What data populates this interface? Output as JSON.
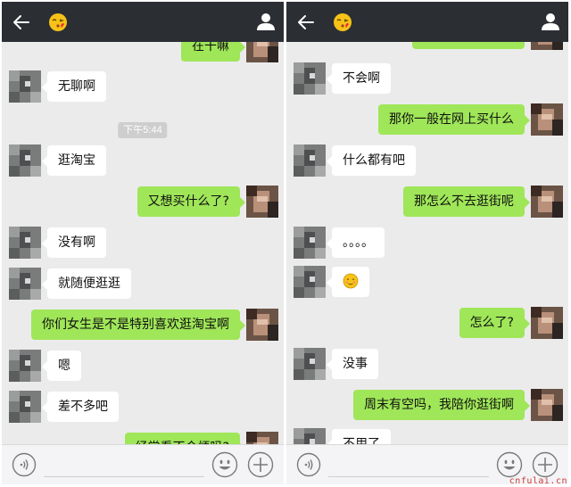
{
  "left_panel": {
    "messages": [
      {
        "side": "out",
        "text": "在干嘛",
        "partial": true
      },
      {
        "side": "in",
        "text": "无聊啊"
      },
      {
        "side": "time",
        "text": "下午5:44"
      },
      {
        "side": "in",
        "text": "逛淘宝"
      },
      {
        "side": "out",
        "text": "又想买什么了?"
      },
      {
        "side": "in",
        "text": "没有啊"
      },
      {
        "side": "in",
        "text": "就随便逛逛"
      },
      {
        "side": "out",
        "text": "你们女生是不是特别喜欢逛淘宝啊"
      },
      {
        "side": "in",
        "text": "嗯"
      },
      {
        "side": "in",
        "text": "差不多吧"
      },
      {
        "side": "out",
        "text": "经常看不会烦吗?",
        "partial": true
      }
    ]
  },
  "right_panel": {
    "messages": [
      {
        "side": "out",
        "text": "",
        "partial": true
      },
      {
        "side": "in",
        "text": "不会啊"
      },
      {
        "side": "out",
        "text": "那你一般在网上买什么"
      },
      {
        "side": "in",
        "text": "什么都有吧"
      },
      {
        "side": "out",
        "text": "那怎么不去逛街呢"
      },
      {
        "side": "in",
        "text": "。。。。"
      },
      {
        "side": "in",
        "text": "",
        "emoji": "shy-smile"
      },
      {
        "side": "out",
        "text": "怎么了?"
      },
      {
        "side": "in",
        "text": "没事"
      },
      {
        "side": "out",
        "text": "周末有空吗，我陪你逛街啊"
      },
      {
        "side": "in",
        "text": "不用了",
        "partial": true
      }
    ]
  },
  "header": {
    "back_icon": "arrow-left-icon",
    "title_icon": "kiss-emoji-icon",
    "profile_icon": "person-icon"
  },
  "toolbar": {
    "voice_icon": "voice-icon",
    "emoji_icon": "smile-icon",
    "more_icon": "plus-icon"
  },
  "watermark": "cnfulai.cn",
  "colors": {
    "topbar": "#2b2e33",
    "chat_bg": "#ebebeb",
    "outgoing_bubble": "#9fe658",
    "incoming_bubble": "#ffffff",
    "time_badge": "#cecece",
    "watermark": "#c83a3a"
  }
}
